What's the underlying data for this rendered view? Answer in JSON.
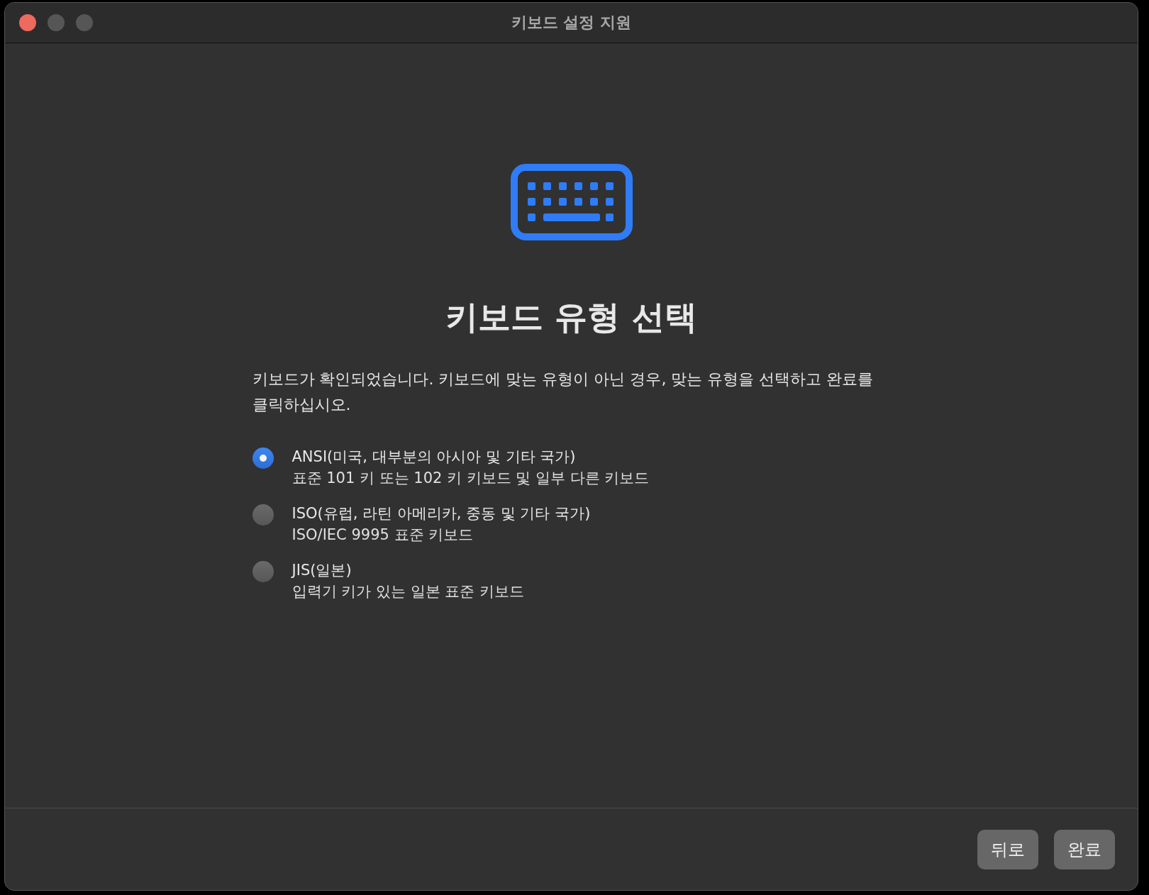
{
  "window": {
    "title": "키보드 설정 지원"
  },
  "heading": "키보드 유형 선택",
  "description": "키보드가 확인되었습니다. 키보드에 맞는 유형이 아닌 경우, 맞는 유형을 선택하고 완료를 클릭하십시오.",
  "options": [
    {
      "label": "ANSI(미국, 대부분의 아시아 및 기타 국가)",
      "detail": "표준 101 키 또는 102 키 키보드 및 일부 다른 키보드",
      "selected": true
    },
    {
      "label": "ISO(유럽, 라틴 아메리카, 중동 및 기타 국가)",
      "detail": "ISO/IEC 9995 표준 키보드",
      "selected": false
    },
    {
      "label": "JIS(일본)",
      "detail": "입력기 키가 있는 일본 표준 키보드",
      "selected": false
    }
  ],
  "buttons": [
    "뒤로",
    "완료"
  ]
}
